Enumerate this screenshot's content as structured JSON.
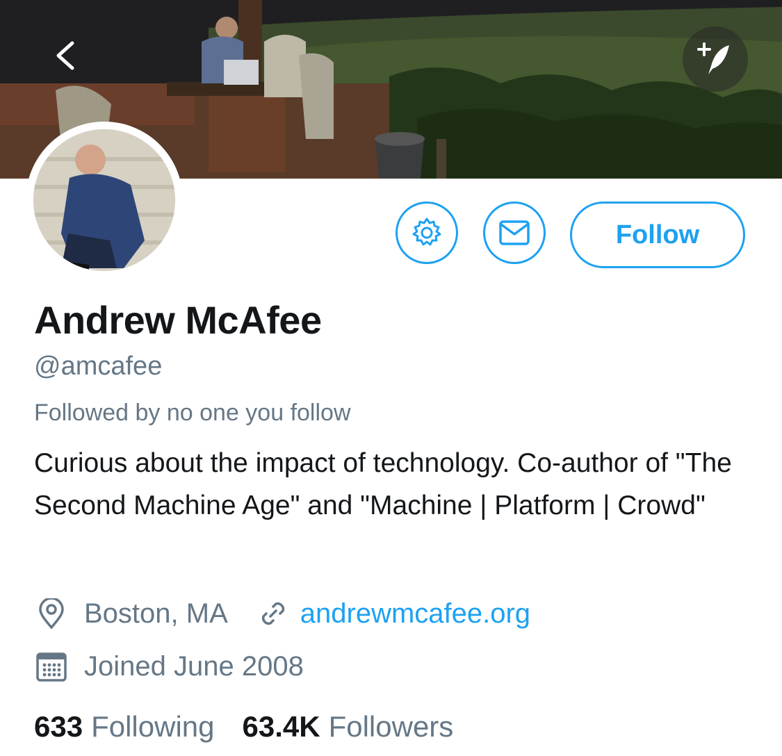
{
  "header": {
    "back_icon": "chevron-left-icon",
    "compose_icon": "compose-tweet-icon"
  },
  "profile": {
    "name": "Andrew McAfee",
    "handle": "@amcafee",
    "followed_by": "Followed by no one you follow",
    "bio": "Curious about the impact of technology. Co-author of \"The Second Machine Age\" and \"Machine | Platform | Crowd\"",
    "location": "Boston, MA",
    "website": "andrewmcafee.org",
    "joined": "Joined June 2008"
  },
  "actions": {
    "settings_icon": "gear-icon",
    "message_icon": "envelope-icon",
    "follow_label": "Follow"
  },
  "stats": {
    "following_count": "633",
    "following_label": "Following",
    "followers_count": "63.4K",
    "followers_label": "Followers"
  },
  "colors": {
    "accent": "#1da1f2",
    "text_primary": "#14171a",
    "text_secondary": "#657786"
  }
}
